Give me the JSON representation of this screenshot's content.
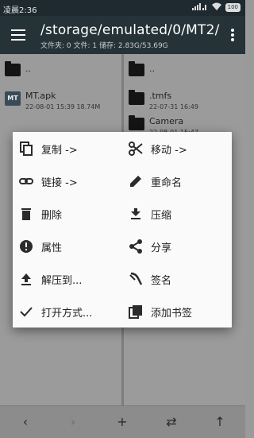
{
  "status_bar": {
    "time": "凌晨2:36",
    "battery": "100"
  },
  "toolbar": {
    "path": "/storage/emulated/0/MT2/",
    "meta": "文件夹: 0  文件: 1  储存: 2.83G/53.69G"
  },
  "left_pane": {
    "parent": "..",
    "files": [
      {
        "name": "MT.apk",
        "info": "22-08-01 15:39  18.74M",
        "icon": "apk-icon"
      }
    ]
  },
  "right_pane": {
    "parent": "..",
    "files": [
      {
        "name": ".tmfs",
        "info": "22-07-31 16:49"
      },
      {
        "name": "Camera",
        "info": "22-08-01 15:47"
      }
    ]
  },
  "menu": {
    "left": [
      {
        "label": "复制 ->",
        "icon": "copy-icon"
      },
      {
        "label": "链接 ->",
        "icon": "link-icon"
      },
      {
        "label": "删除",
        "icon": "delete-icon"
      },
      {
        "label": "属性",
        "icon": "info-icon"
      },
      {
        "label": "解压到...",
        "icon": "extract-to-icon"
      },
      {
        "label": "打开方式...",
        "icon": "check-icon"
      }
    ],
    "right": [
      {
        "label": "移动 ->",
        "icon": "scissors-icon"
      },
      {
        "label": "重命名",
        "icon": "pencil-icon"
      },
      {
        "label": "压缩",
        "icon": "compress-icon"
      },
      {
        "label": "分享",
        "icon": "share-icon"
      },
      {
        "label": "签名",
        "icon": "signature-icon"
      },
      {
        "label": "添加书签",
        "icon": "bookmark-icon"
      }
    ]
  },
  "colors": {
    "toolbar": "#253238",
    "dialog": "#fafafa",
    "icon": "#2b2b2b"
  }
}
